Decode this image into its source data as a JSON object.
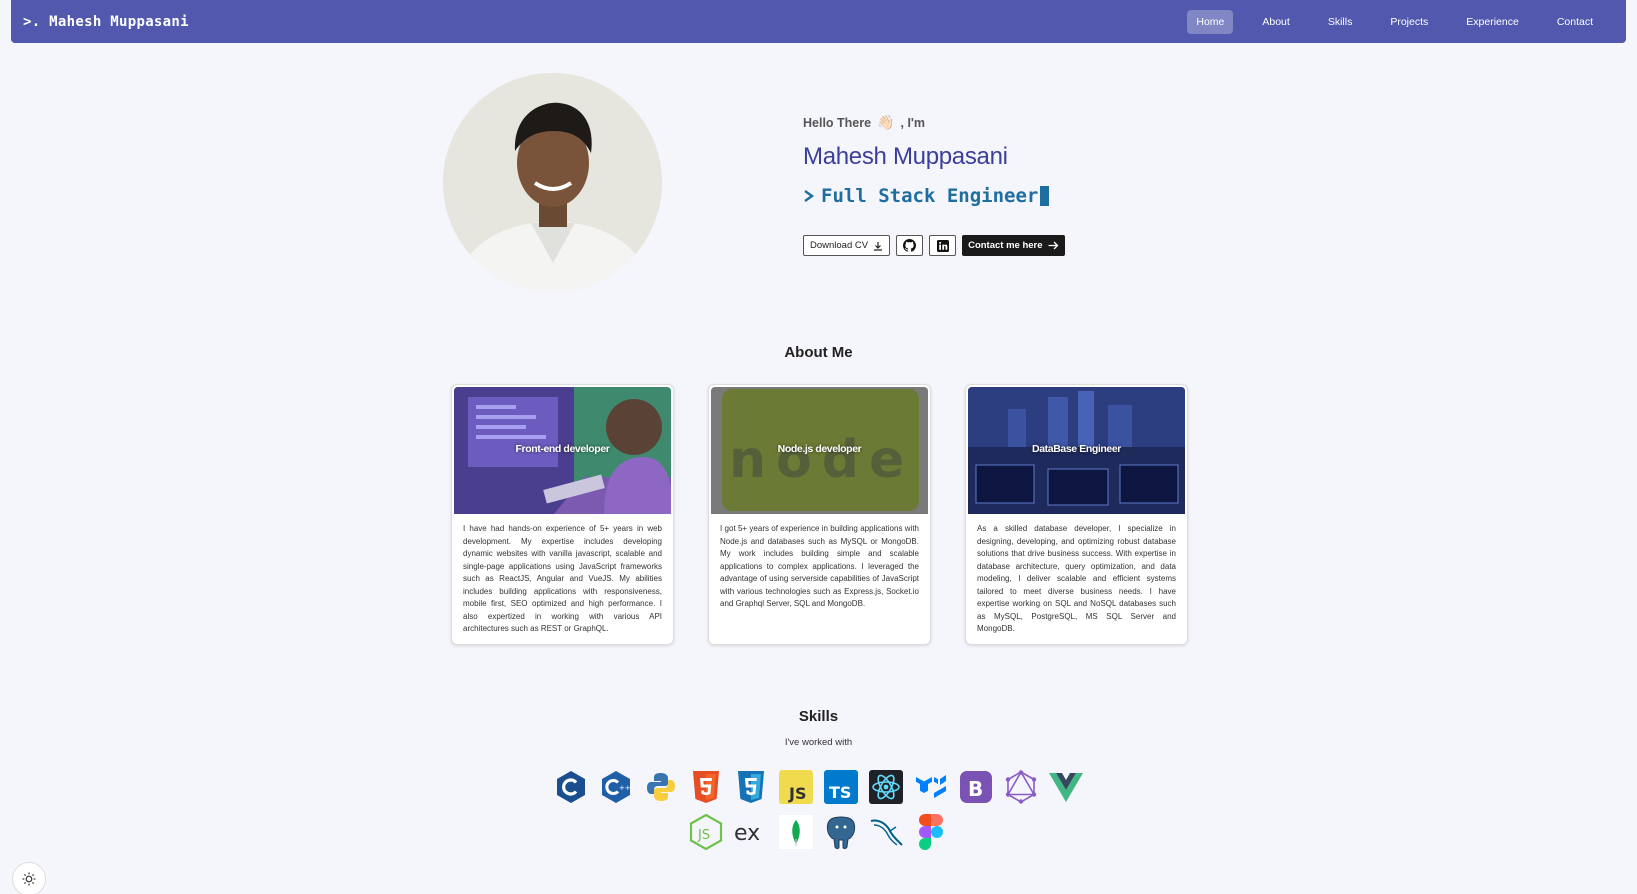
{
  "brand": ">. Mahesh Muppasani",
  "nav": [
    "Home",
    "About",
    "Skills",
    "Projects",
    "Experience",
    "Contact"
  ],
  "hero": {
    "greeting": "Hello There",
    "greeting_suffix": ", I'm",
    "wave_icon": "👋🏻",
    "name": "Mahesh Muppasani",
    "role": "Full Stack Engineer",
    "download_cv": "Download CV",
    "contact": "Contact me here"
  },
  "about": {
    "title": "About Me",
    "cards": [
      {
        "title": "Front-end developer",
        "text": "I have had hands-on experience of 5+ years in web development. My expertise includes developing dynamic websites with vanilla javascript, scalable and single-page applications using JavaScript frameworks such as ReactJS, Angular and VueJS. My abilities includes building applications with responsiveness, mobile first, SEO optimized and high performance. I also expertized in working with various API architectures such as REST or GraphQL."
      },
      {
        "title": "Node.js developer",
        "text": "I got 5+ years of experience in building applications with Node.js and databases such as MySQL or MongoDB. My work includes building simple and scalable applications to complex applications. I leveraged the advantage of using serverside capabilities of JavaScript with various technologies such as Express.js, Socket.io and Graphql Server, SQL and MongoDB."
      },
      {
        "title": "DataBase Engineer",
        "text": "As a skilled database developer, I specialize in designing, developing, and optimizing robust database solutions that drive business success. With expertise in database architecture, query optimization, and data modeling, I deliver scalable and efficient systems tailored to meet diverse business needs. I have expertise working on SQL and NoSQL databases such as MySQL, PostgreSQL, MS SQL Server and MongoDB."
      }
    ]
  },
  "skills": {
    "title": "Skills",
    "subtitle": "I've worked with",
    "row1": [
      "c-icon",
      "cpp-icon",
      "python-icon",
      "html5-icon",
      "css3-icon",
      "javascript-icon",
      "typescript-icon",
      "react-icon",
      "mui-icon",
      "bootstrap-icon",
      "graphql-icon",
      "vue-icon"
    ],
    "row2": [
      "nodejs-icon",
      "express-icon",
      "mongodb-icon",
      "postgresql-icon",
      "mysql-icon",
      "figma-icon"
    ]
  },
  "colors": {
    "navbar": "#5158ad",
    "name": "#3b3f9a",
    "role": "#1e6fa0"
  }
}
